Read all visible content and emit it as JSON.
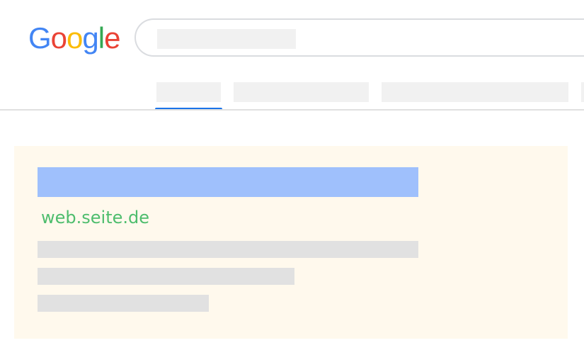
{
  "logo": {
    "letters": [
      "G",
      "o",
      "o",
      "g",
      "l",
      "e"
    ],
    "colors": [
      "#4285f4",
      "#ea4335",
      "#fbbc05",
      "#4285f4",
      "#34a853",
      "#ea4335"
    ]
  },
  "search": {
    "value": ""
  },
  "tabs": {
    "active_index": 0,
    "active_color": "#1a73e8"
  },
  "result": {
    "url": "web.seite.de",
    "url_color": "#4ebd6d",
    "title_color": "#9fc0fc",
    "background": "#fff9ed"
  }
}
